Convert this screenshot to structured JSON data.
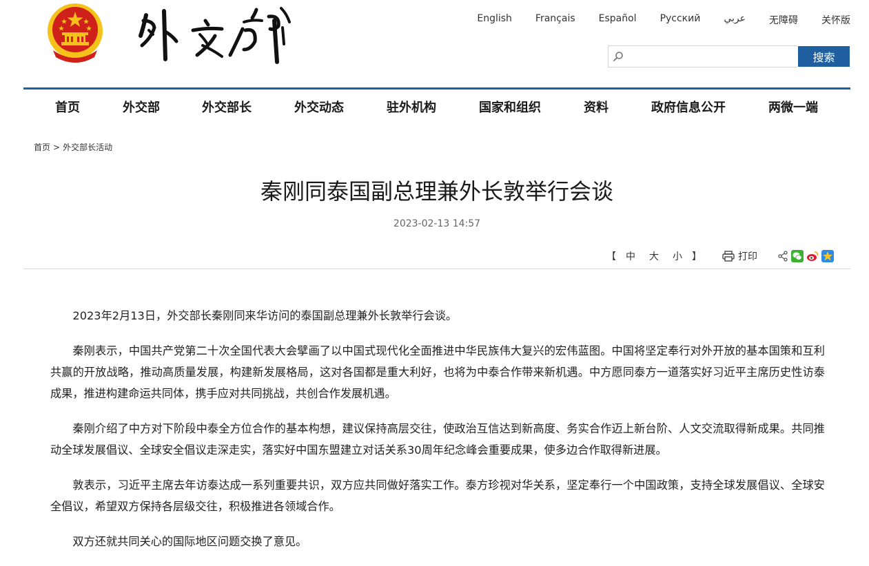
{
  "header": {
    "languages": [
      "English",
      "Français",
      "Español",
      "Русский",
      "عربي",
      "无障碍",
      "关怀版"
    ],
    "search": {
      "placeholder": "",
      "button_label": "搜索"
    }
  },
  "nav": {
    "items": [
      "首页",
      "外交部",
      "外交部长",
      "外交动态",
      "驻外机构",
      "国家和组织",
      "资料",
      "政府信息公开",
      "两微一端"
    ]
  },
  "breadcrumb": {
    "home": "首页",
    "separator": ">",
    "current": "外交部长活动"
  },
  "article": {
    "title": "秦刚同泰国副总理兼外长敦举行会谈",
    "date": "2023-02-13 14:57",
    "font_size_bracket_open": "【",
    "font_size_options": [
      "中",
      "大",
      "小"
    ],
    "font_size_bracket_close": "】",
    "print_label": "打印",
    "paragraphs": [
      "2023年2月13日，外交部长秦刚同来华访问的泰国副总理兼外长敦举行会谈。",
      "秦刚表示，中国共产党第二十次全国代表大会擘画了以中国式现代化全面推进中华民族伟大复兴的宏伟蓝图。中国将坚定奉行对外开放的基本国策和互利共赢的开放战略，推动高质量发展，构建新发展格局，这对各国都是重大利好，也将为中泰合作带来新机遇。中方愿同泰方一道落实好习近平主席历史性访泰成果，推进构建命运共同体，携手应对共同挑战，共创合作发展机遇。",
      "秦刚介绍了中方对下阶段中泰全方位合作的基本构想，建议保持高层交往，使政治互信达到新高度、务实合作迈上新台阶、人文交流取得新成果。共同推动全球发展倡议、全球安全倡议走深走实，落实好中国东盟建立对话关系30周年纪念峰会重要成果，使多边合作取得新进展。",
      "敦表示，习近平主席去年访泰达成一系列重要共识，双方应共同做好落实工作。泰方珍视对华关系，坚定奉行一个中国政策，支持全球发展倡议、全球安全倡议，希望双方保持各层级交往，积极推进各领域合作。",
      "双方还就共同关心的国际地区问题交换了意见。"
    ]
  },
  "colors": {
    "accent": "#1b5fa6",
    "search_button": "#1f5f9f",
    "emblem_red": "#d0201a",
    "emblem_gold": "#f5c21b"
  },
  "icons": [
    "national-emblem",
    "mfa-calligraphy-logo",
    "search-icon",
    "printer-icon",
    "share-icon",
    "wechat-icon",
    "weibo-icon",
    "qzone-icon"
  ]
}
